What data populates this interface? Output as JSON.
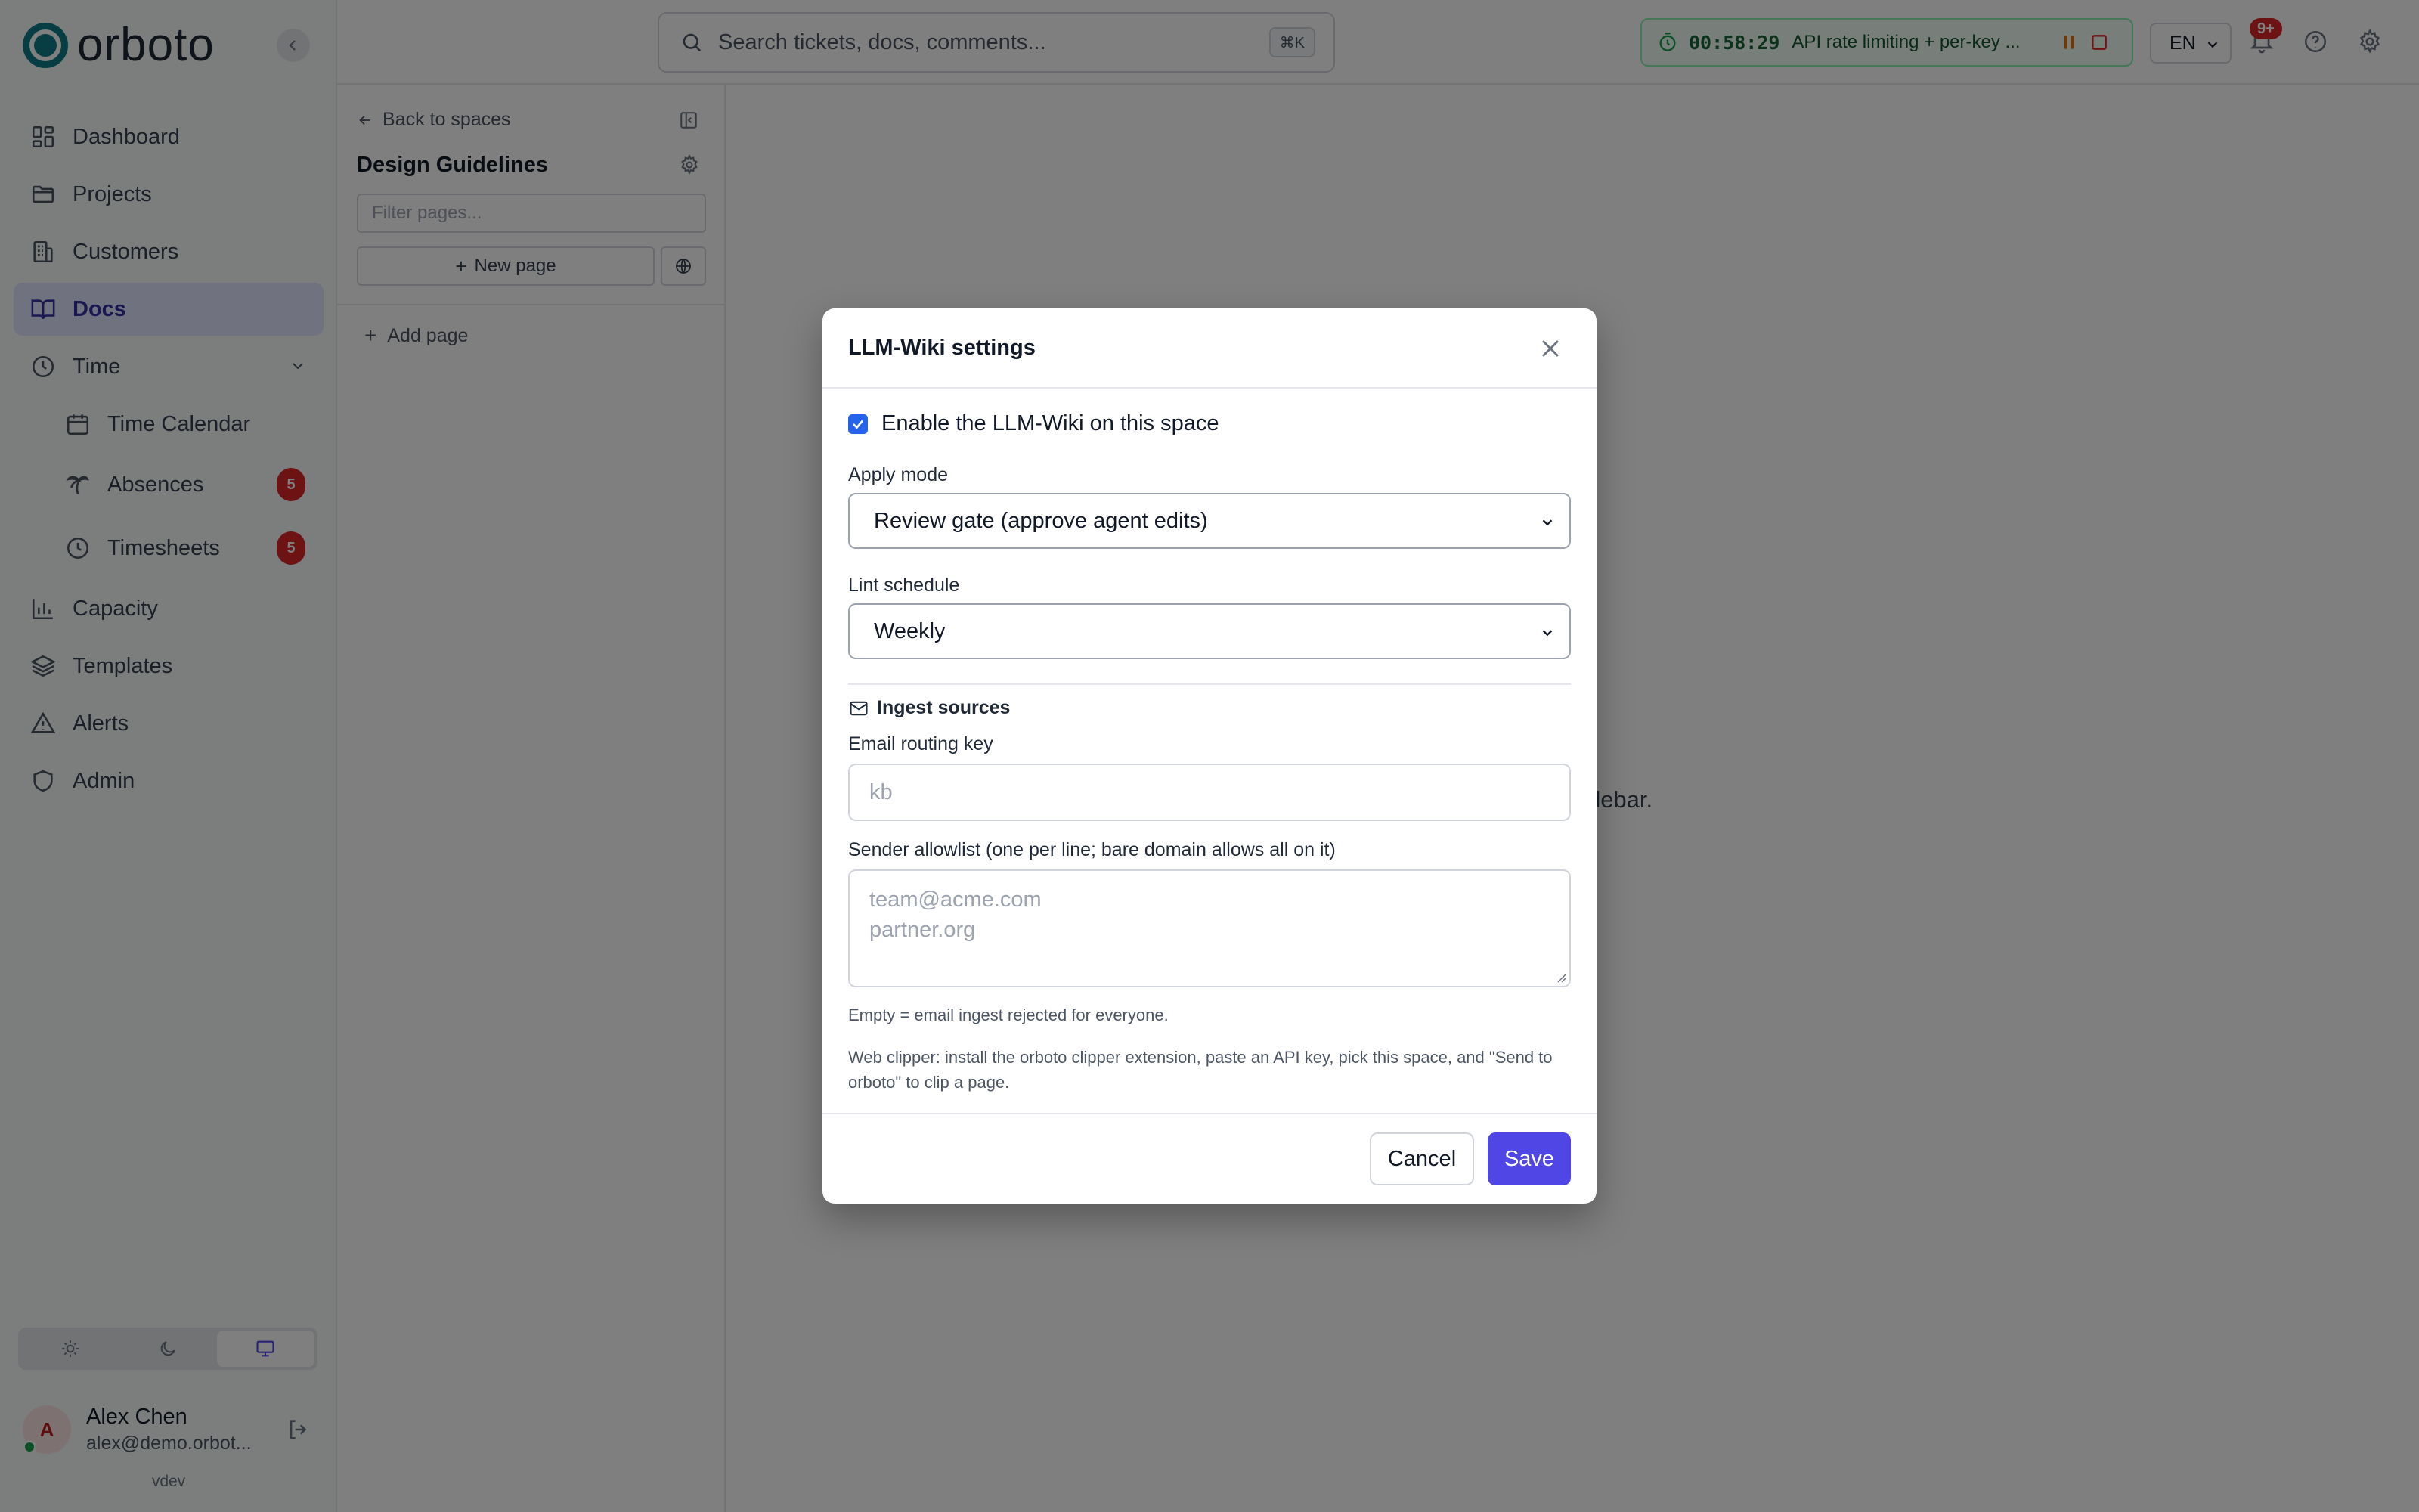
{
  "app": {
    "name": "orboto",
    "version": "vdev"
  },
  "sidebar": {
    "items": [
      {
        "label": "Dashboard",
        "icon": "grid-icon"
      },
      {
        "label": "Projects",
        "icon": "folder-icon"
      },
      {
        "label": "Customers",
        "icon": "building-icon"
      },
      {
        "label": "Docs",
        "icon": "book-icon",
        "active": true
      },
      {
        "label": "Time",
        "icon": "clock-icon",
        "expanded": true
      },
      {
        "label": "Time Calendar",
        "icon": "calendar-icon"
      },
      {
        "label": "Absences",
        "icon": "palm-tree-icon",
        "badge": "5"
      },
      {
        "label": "Timesheets",
        "icon": "clock-icon",
        "badge": "5"
      },
      {
        "label": "Capacity",
        "icon": "bar-chart-icon"
      },
      {
        "label": "Templates",
        "icon": "layers-icon"
      },
      {
        "label": "Alerts",
        "icon": "alert-triangle-icon"
      },
      {
        "label": "Admin",
        "icon": "shield-icon"
      }
    ],
    "theme_options": [
      "light",
      "dark",
      "system"
    ],
    "theme_selected": "system",
    "user": {
      "initial": "A",
      "name": "Alex Chen",
      "email": "alex@demo.orbot..."
    }
  },
  "topbar": {
    "search_placeholder": "Search tickets, docs, comments...",
    "search_shortcut": "⌘K",
    "timer": {
      "time": "00:58:29",
      "task": "API rate limiting + per-key ..."
    },
    "language": "EN",
    "notifications_badge": "9+"
  },
  "docs_panel": {
    "back_label": "Back to spaces",
    "space_title": "Design Guidelines",
    "filter_placeholder": "Filter pages...",
    "new_page_label": "New page",
    "add_page_label": "Add page"
  },
  "main": {
    "empty_hint": "n the sidebar."
  },
  "modal": {
    "title": "LLM-Wiki settings",
    "enable_label": "Enable the LLM-Wiki on this space",
    "enable_checked": true,
    "apply_mode_label": "Apply mode",
    "apply_mode_value": "Review gate (approve agent edits)",
    "lint_schedule_label": "Lint schedule",
    "lint_schedule_value": "Weekly",
    "ingest_heading": "Ingest sources",
    "email_key_label": "Email routing key",
    "email_key_placeholder": "kb",
    "allowlist_label": "Sender allowlist (one per line; bare domain allows all on it)",
    "allowlist_placeholder_lines": [
      "team@acme.com",
      "partner.org"
    ],
    "empty_hint": "Empty = email ingest rejected for everyone.",
    "clipper_hint": "Web clipper: install the orboto clipper extension, paste an API key, pick this space, and \"Send to orboto\" to clip a page.",
    "cancel_label": "Cancel",
    "save_label": "Save"
  },
  "colors": {
    "accent": "#4f46e5",
    "brand": "#0d7c86",
    "badge": "#dc2626",
    "timer_bg": "#f0fdf4"
  }
}
